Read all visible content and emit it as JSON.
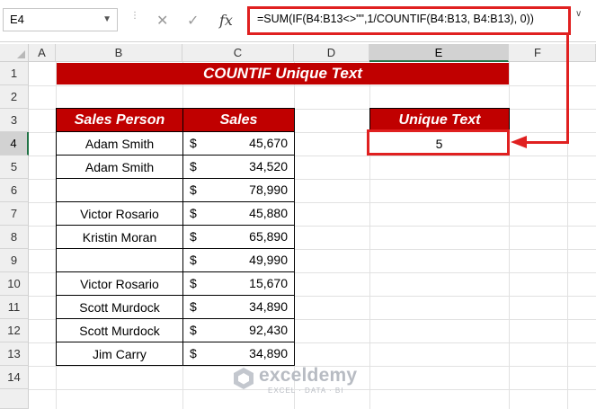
{
  "formula_bar": {
    "name_box": "E4",
    "cancel_symbol": "✕",
    "enter_symbol": "✓",
    "fx_label": "fx",
    "formula": "=SUM(IF(B4:B13<>\"\",1/COUNTIF(B4:B13, B4:B13), 0))"
  },
  "columns": [
    "A",
    "B",
    "C",
    "D",
    "E",
    "F"
  ],
  "rows": [
    "1",
    "2",
    "3",
    "4",
    "5",
    "6",
    "7",
    "8",
    "9",
    "10",
    "11",
    "12",
    "13",
    "14"
  ],
  "selected_cell": {
    "column": "E",
    "row": "4"
  },
  "title": "COUNTIF Unique Text",
  "table": {
    "headers": [
      "Sales Person",
      "Sales"
    ],
    "currency_symbol": "$",
    "rows": [
      {
        "person": "Adam Smith",
        "sales": "45,670"
      },
      {
        "person": "Adam Smith",
        "sales": "34,520"
      },
      {
        "person": "",
        "sales": "78,990"
      },
      {
        "person": "Victor Rosario",
        "sales": "45,880"
      },
      {
        "person": "Kristin Moran",
        "sales": "65,890"
      },
      {
        "person": "",
        "sales": "49,990"
      },
      {
        "person": "Victor Rosario",
        "sales": "15,670"
      },
      {
        "person": "Scott Murdock",
        "sales": "34,890"
      },
      {
        "person": "Scott Murdock",
        "sales": "92,430"
      },
      {
        "person": "Jim Carry",
        "sales": "34,890"
      }
    ]
  },
  "result": {
    "header": "Unique Text",
    "value": "5"
  },
  "watermark": {
    "name": "exceldemy",
    "tagline": "EXCEL · DATA · BI"
  },
  "colors": {
    "header_red": "#c00000",
    "highlight_red": "#e02020",
    "excel_green": "#217346"
  }
}
